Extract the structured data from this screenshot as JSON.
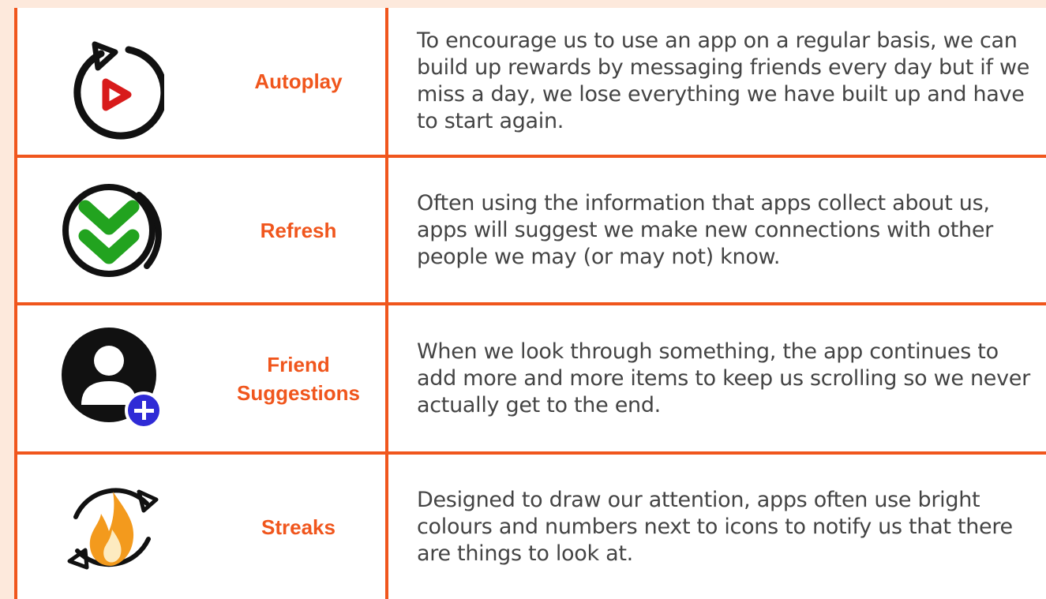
{
  "colors": {
    "accent": "#f0561d",
    "background": "#fde9dc",
    "text": "#444444"
  },
  "rows": [
    {
      "label": "Autoplay",
      "icon": "autoplay-icon",
      "description": "To encourage us to use an app on a regular basis, we can build up rewards by messaging friends every day but if we miss a day, we lose everything we have built up and have to start again."
    },
    {
      "label": "Refresh",
      "icon": "refresh-chevrons-icon",
      "description": "Often using the information that apps collect about us, apps will suggest we make new connections with other people we may (or may not) know."
    },
    {
      "label": "Friend Suggestions",
      "icon": "add-user-icon",
      "description": "When we look through something, the app continues to add more and more items to keep us scrolling so we never actually get to the end."
    },
    {
      "label": "Streaks",
      "icon": "flame-cycle-icon",
      "description": "Designed to draw our attention, apps often use bright colours and numbers next to icons to notify us that there are things to look at."
    }
  ]
}
